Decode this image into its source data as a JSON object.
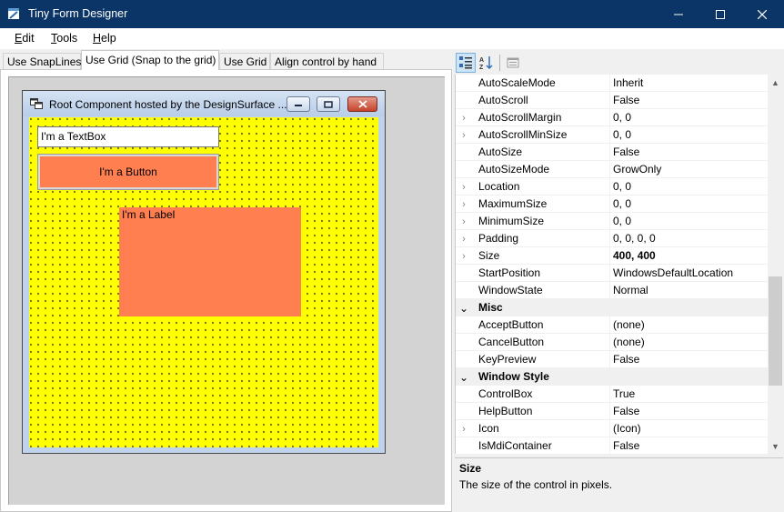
{
  "app": {
    "title": "Tiny Form Designer",
    "window_buttons": {
      "minimize": "—",
      "maximize": "☐",
      "close": "✕"
    }
  },
  "menu": [
    {
      "label_u": "E",
      "label_rest": "dit"
    },
    {
      "label_u": "T",
      "label_rest": "ools"
    },
    {
      "label_u": "H",
      "label_rest": "elp"
    }
  ],
  "tabs": [
    {
      "label": "Use SnapLines",
      "active": false
    },
    {
      "label": "Use Grid (Snap to the grid)",
      "active": true
    },
    {
      "label": "Use Grid",
      "active": false
    },
    {
      "label": "Align control by hand",
      "active": false
    }
  ],
  "hosted_form": {
    "title": "Root Component hosted by the DesignSurface ...",
    "textbox_text": "I'm a TextBox",
    "button_text": "I'm a Button",
    "label_text": "I'm a Label",
    "client_color": "#ffff00",
    "control_color": "#ff7f50"
  },
  "property_grid": {
    "rows": [
      {
        "type": "prop",
        "expandable": false,
        "name": "AutoScaleMode",
        "value": "Inherit"
      },
      {
        "type": "prop",
        "expandable": false,
        "name": "AutoScroll",
        "value": "False"
      },
      {
        "type": "prop",
        "expandable": true,
        "name": "AutoScrollMargin",
        "value": "0, 0"
      },
      {
        "type": "prop",
        "expandable": true,
        "name": "AutoScrollMinSize",
        "value": "0, 0"
      },
      {
        "type": "prop",
        "expandable": false,
        "name": "AutoSize",
        "value": "False"
      },
      {
        "type": "prop",
        "expandable": false,
        "name": "AutoSizeMode",
        "value": "GrowOnly"
      },
      {
        "type": "prop",
        "expandable": true,
        "name": "Location",
        "value": "0, 0"
      },
      {
        "type": "prop",
        "expandable": true,
        "name": "MaximumSize",
        "value": "0, 0"
      },
      {
        "type": "prop",
        "expandable": true,
        "name": "MinimumSize",
        "value": "0, 0"
      },
      {
        "type": "prop",
        "expandable": true,
        "name": "Padding",
        "value": "0, 0, 0, 0"
      },
      {
        "type": "prop",
        "expandable": true,
        "name": "Size",
        "value": "400, 400",
        "bold": true
      },
      {
        "type": "prop",
        "expandable": false,
        "name": "StartPosition",
        "value": "WindowsDefaultLocation"
      },
      {
        "type": "prop",
        "expandable": false,
        "name": "WindowState",
        "value": "Normal"
      },
      {
        "type": "category",
        "name": "Misc"
      },
      {
        "type": "prop",
        "expandable": false,
        "name": "AcceptButton",
        "value": "(none)"
      },
      {
        "type": "prop",
        "expandable": false,
        "name": "CancelButton",
        "value": "(none)"
      },
      {
        "type": "prop",
        "expandable": false,
        "name": "KeyPreview",
        "value": "False"
      },
      {
        "type": "category",
        "name": "Window Style"
      },
      {
        "type": "prop",
        "expandable": false,
        "name": "ControlBox",
        "value": "True"
      },
      {
        "type": "prop",
        "expandable": false,
        "name": "HelpButton",
        "value": "False"
      },
      {
        "type": "prop",
        "expandable": true,
        "name": "Icon",
        "value": "(Icon)"
      },
      {
        "type": "prop",
        "expandable": false,
        "name": "IsMdiContainer",
        "value": "False"
      }
    ],
    "help_title": "Size",
    "help_description": "The size of the control in pixels."
  }
}
